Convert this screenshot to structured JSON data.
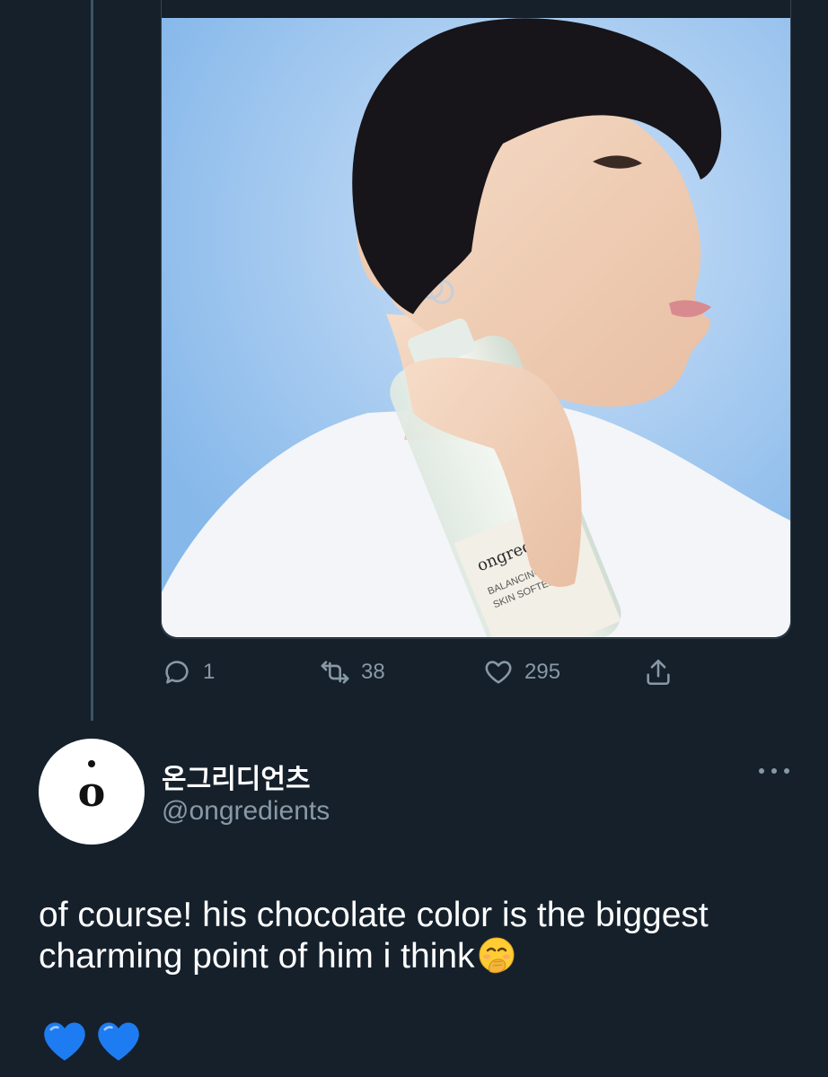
{
  "tweet_media": {
    "alt": "Model holding ongredients Balancing Skin Softener bottle",
    "bottle_brand": "ongredients",
    "bottle_label_line1": "BALANCING",
    "bottle_label_line2": "SKIN SOFTENER"
  },
  "action_bar": {
    "reply_count": "1",
    "retweet_count": "38",
    "like_count": "295",
    "icons": [
      "reply-icon",
      "retweet-icon",
      "like-icon",
      "share-icon"
    ]
  },
  "reply": {
    "avatar_letter": "o",
    "display_name": "온그리디언츠",
    "handle": "@ongredients",
    "text": "of course! his chocolate color is the biggest charming point of him i think",
    "emoji_inline": "face-with-hand-over-mouth",
    "trailing_emojis": [
      "blue-heart",
      "blue-heart"
    ]
  },
  "colors": {
    "background": "#15202b",
    "secondary_text": "#8899a6",
    "thread_line": "#3d5466",
    "heart_blue": "#1e7cf2"
  }
}
